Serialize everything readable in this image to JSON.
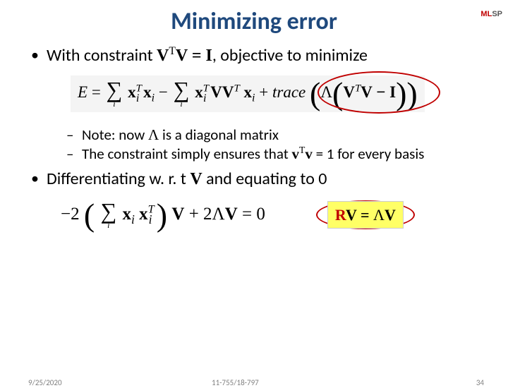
{
  "logo": {
    "ml": "ML",
    "sp": "SP"
  },
  "title": "Minimizing error",
  "bullet1": {
    "pre": "With constraint ",
    "vtv": "V",
    "sup": "T",
    "v2": "V = I",
    "post": ", objective to minimize"
  },
  "eq1": {
    "E": "E",
    "eq": " = ",
    "term1a": "x",
    "t1sup": "T",
    "t1sub": "i",
    "x2": "x",
    "x2sub": "i",
    "minus": " − ",
    "term2a": "x",
    "t2sup": "T",
    "t2sub": "i",
    "VV": "VV",
    "VVsup": "T",
    "x3": "x",
    "x3sub": "i",
    "plus": " + ",
    "trace": "trace",
    "Lam": "Λ",
    "inner1": "V",
    "innersup": "T",
    "inner2": "V − I"
  },
  "note1": {
    "pre": "Note: now ",
    "lam": "Λ",
    "post": " is a diagonal matrix"
  },
  "note2": {
    "pre": "The constraint simply ensures that ",
    "v": "v",
    "sup": "T",
    "v2": "v",
    "post": " = 1 for every basis"
  },
  "bullet2": {
    "pre": "Differentiating w. r. t  ",
    "V": "V",
    "post": " and equating to 0"
  },
  "eq2": {
    "neg2": "−2",
    "x": "x",
    "xsub": "i",
    "x2": "x",
    "x2sup": "T",
    "x2sub": "i",
    "V": "V",
    "plus": " + 2",
    "Lam": "Λ",
    "V2": "V",
    "eq0": " = 0"
  },
  "result": {
    "R": "R",
    "V": "V = ",
    "Lam": "Λ",
    "V2": "V"
  },
  "footer": {
    "date": "9/25/2020",
    "course": "11-755/18-797",
    "page": "34"
  }
}
